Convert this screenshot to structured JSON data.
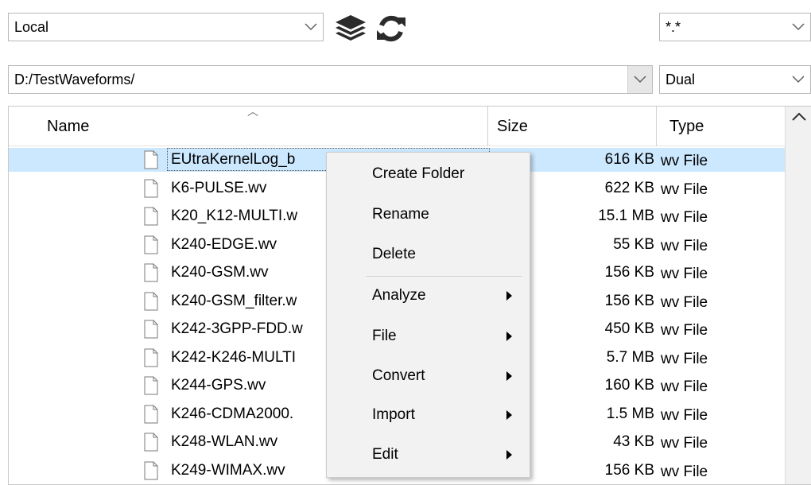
{
  "toolbar": {
    "location_select": "Local",
    "filter_select": "*.*",
    "path_select": "D:/TestWaveforms/",
    "mode_select": "Dual",
    "stack_icon": "layers-icon",
    "refresh_icon": "refresh-icon"
  },
  "columns": {
    "name": "Name",
    "size": "Size",
    "type": "Type"
  },
  "files": [
    {
      "name": "EUtraKernelLog_b",
      "size": "616 KB",
      "type": "wv File",
      "selected": true
    },
    {
      "name": "K6-PULSE.wv",
      "size": "622 KB",
      "type": "wv File"
    },
    {
      "name": "K20_K12-MULTI.w",
      "size": "15.1 MB",
      "type": "wv File"
    },
    {
      "name": "K240-EDGE.wv",
      "size": "55 KB",
      "type": "wv File"
    },
    {
      "name": "K240-GSM.wv",
      "size": "156 KB",
      "type": "wv File"
    },
    {
      "name": "K240-GSM_filter.w",
      "size": "156 KB",
      "type": "wv File"
    },
    {
      "name": "K242-3GPP-FDD.w",
      "size": "450 KB",
      "type": "wv File"
    },
    {
      "name": "K242-K246-MULTI",
      "size": "5.7 MB",
      "type": "wv File"
    },
    {
      "name": "K244-GPS.wv",
      "size": "160 KB",
      "type": "wv File"
    },
    {
      "name": "K246-CDMA2000.",
      "size": "1.5 MB",
      "type": "wv File"
    },
    {
      "name": "K248-WLAN.wv",
      "size": "43 KB",
      "type": "wv File"
    },
    {
      "name": "K249-WIMAX.wv",
      "size": "156 KB",
      "type": "wv File"
    }
  ],
  "context_menu": {
    "items": [
      {
        "label": "Create Folder",
        "submenu": false
      },
      {
        "label": "Rename",
        "submenu": false
      },
      {
        "label": "Delete",
        "submenu": false
      },
      {
        "label": "Analyze",
        "submenu": true
      },
      {
        "label": "File",
        "submenu": true
      },
      {
        "label": "Convert",
        "submenu": true
      },
      {
        "label": "Import",
        "submenu": true
      },
      {
        "label": "Edit",
        "submenu": true
      }
    ]
  }
}
